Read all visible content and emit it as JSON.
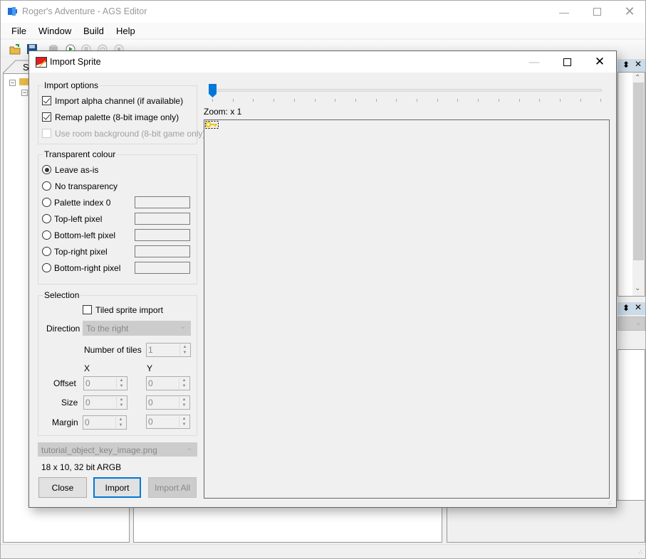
{
  "main_window": {
    "title": "Roger's Adventure - AGS Editor",
    "menu": [
      "File",
      "Window",
      "Build",
      "Help"
    ],
    "toolbar_icons": [
      "open-folder-icon",
      "save-icon",
      "build-icon",
      "run-icon",
      "pause-icon",
      "step-icon",
      "stop-icon"
    ],
    "left_tab_label": "St",
    "statusbar_text": ""
  },
  "dialog": {
    "title": "Import Sprite",
    "import_options": {
      "legend": "Import options",
      "import_alpha": {
        "label": "Import alpha channel (if available)",
        "checked": true
      },
      "remap_palette": {
        "label": "Remap palette (8-bit image only)",
        "checked": true
      },
      "use_room_bg": {
        "label": "Use room background (8-bit game only)",
        "checked": false,
        "disabled": true
      }
    },
    "transparent_colour": {
      "legend": "Transparent colour",
      "options": [
        {
          "label": "Leave as-is",
          "selected": true
        },
        {
          "label": "No transparency",
          "selected": false
        },
        {
          "label": "Palette index 0",
          "selected": false
        },
        {
          "label": "Top-left pixel",
          "selected": false
        },
        {
          "label": "Bottom-left pixel",
          "selected": false
        },
        {
          "label": "Top-right pixel",
          "selected": false
        },
        {
          "label": "Bottom-right pixel",
          "selected": false
        }
      ]
    },
    "selection": {
      "legend": "Selection",
      "tiled_label": "Tiled sprite import",
      "tiled_checked": false,
      "direction_label": "Direction",
      "direction_value": "To the right",
      "num_tiles_label": "Number of tiles",
      "num_tiles_value": "1",
      "x_header": "X",
      "y_header": "Y",
      "offset_label": "Offset",
      "size_label": "Size",
      "margin_label": "Margin",
      "offset_x": "0",
      "offset_y": "0",
      "size_x": "0",
      "size_y": "0",
      "margin_x": "0",
      "margin_y": "0"
    },
    "file_combo": "tutorial_object_key_image.png",
    "image_info": "18 x 10, 32 bit ARGB",
    "buttons": {
      "close": "Close",
      "import": "Import",
      "import_all": "Import All"
    },
    "zoom_label": "Zoom: x 1",
    "zoom_level": 1
  }
}
